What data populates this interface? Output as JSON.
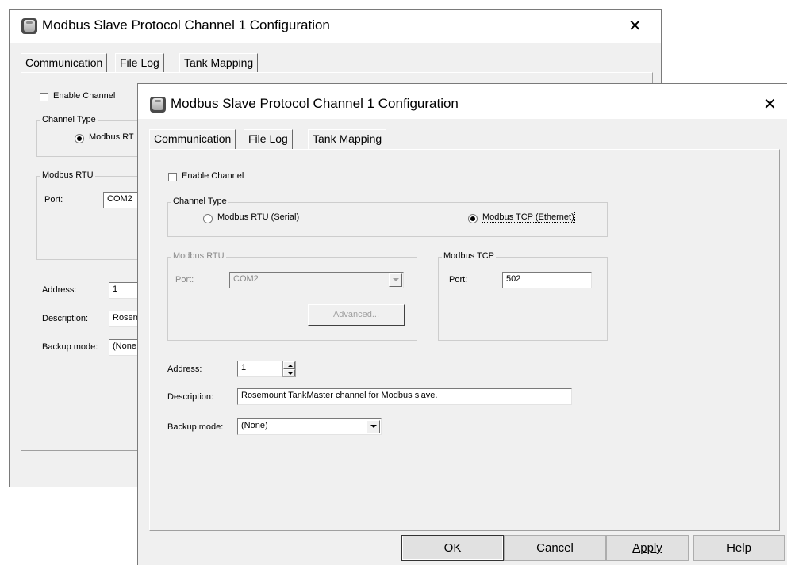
{
  "title": "Modbus Slave Protocol Channel 1 Configuration",
  "close_glyph": "✕",
  "tabs": [
    "Communication",
    "File Log",
    "Tank Mapping"
  ],
  "enable_channel": {
    "label": "Enable Channel",
    "checked": false
  },
  "channel_type": {
    "caption": "Channel Type",
    "rtu_label": "Modbus RTU (Serial)",
    "rtu_label_short": "Modbus RT",
    "tcp_label": "Modbus TCP (Ethernet)",
    "selected_front": "tcp",
    "selected_back": "rtu"
  },
  "modbus_rtu": {
    "caption": "Modbus RTU",
    "port_label": "Port:",
    "port_value": "COM2",
    "advanced_label": "Advanced..."
  },
  "modbus_tcp": {
    "caption": "Modbus TCP",
    "port_label": "Port:",
    "port_value": "502"
  },
  "address": {
    "label": "Address:",
    "value": "1"
  },
  "description": {
    "label": "Description:",
    "value": "Rosemount TankMaster channel for Modbus slave.",
    "value_clipped": "Rosem"
  },
  "backup_mode": {
    "label": "Backup mode:",
    "value": "(None)",
    "value_clipped": "(None"
  },
  "buttons": {
    "ok": "OK",
    "cancel": "Cancel",
    "apply": "Apply",
    "help": "Help"
  },
  "colors": {
    "window_bg": "#f0f0f0",
    "titlebar_bg": "#ffffff",
    "group_border": "#cdcdcd"
  }
}
